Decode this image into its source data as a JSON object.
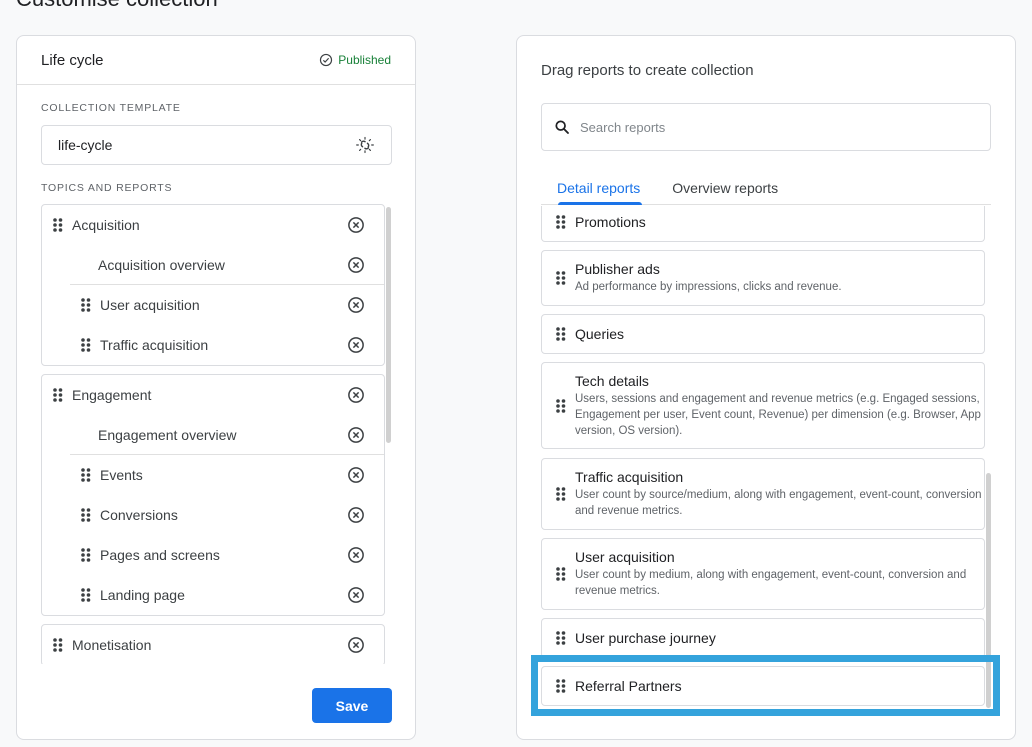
{
  "page": {
    "title": "Customise collection"
  },
  "collection": {
    "name": "Life cycle",
    "status": "Published",
    "template_label": "COLLECTION TEMPLATE",
    "template_value": "life-cycle",
    "topics_label": "TOPICS AND REPORTS",
    "topics": [
      {
        "name": "Acquisition",
        "overview": "Acquisition overview",
        "reports": [
          "User acquisition",
          "Traffic acquisition"
        ]
      },
      {
        "name": "Engagement",
        "overview": "Engagement overview",
        "reports": [
          "Events",
          "Conversions",
          "Pages and screens",
          "Landing page"
        ]
      },
      {
        "name": "Monetisation",
        "overview": null,
        "reports": []
      }
    ],
    "save_label": "Save"
  },
  "library": {
    "heading": "Drag reports to create collection",
    "search_placeholder": "Search reports",
    "tabs": [
      {
        "label": "Detail reports",
        "active": true
      },
      {
        "label": "Overview reports",
        "active": false
      }
    ],
    "reports": [
      {
        "name": "Promotions",
        "description": ""
      },
      {
        "name": "Publisher ads",
        "description": "Ad performance by impressions, clicks and revenue."
      },
      {
        "name": "Queries",
        "description": ""
      },
      {
        "name": "Tech details",
        "description": "Users, sessions and engagement and revenue metrics (e.g. Engaged sessions, Engagement per user, Event count, Revenue) per dimension (e.g. Browser, App version, OS version)."
      },
      {
        "name": "Traffic acquisition",
        "description": "User count by source/medium, along with engagement, event-count, conversion and revenue metrics."
      },
      {
        "name": "User acquisition",
        "description": "User count by medium, along with engagement, event-count, conversion and revenue metrics."
      },
      {
        "name": "User purchase journey",
        "description": ""
      },
      {
        "name": "Referral Partners",
        "description": "",
        "highlighted": true
      }
    ]
  },
  "colors": {
    "accent": "#1a73e8",
    "published": "#188038",
    "highlight": "#34a3dc"
  }
}
